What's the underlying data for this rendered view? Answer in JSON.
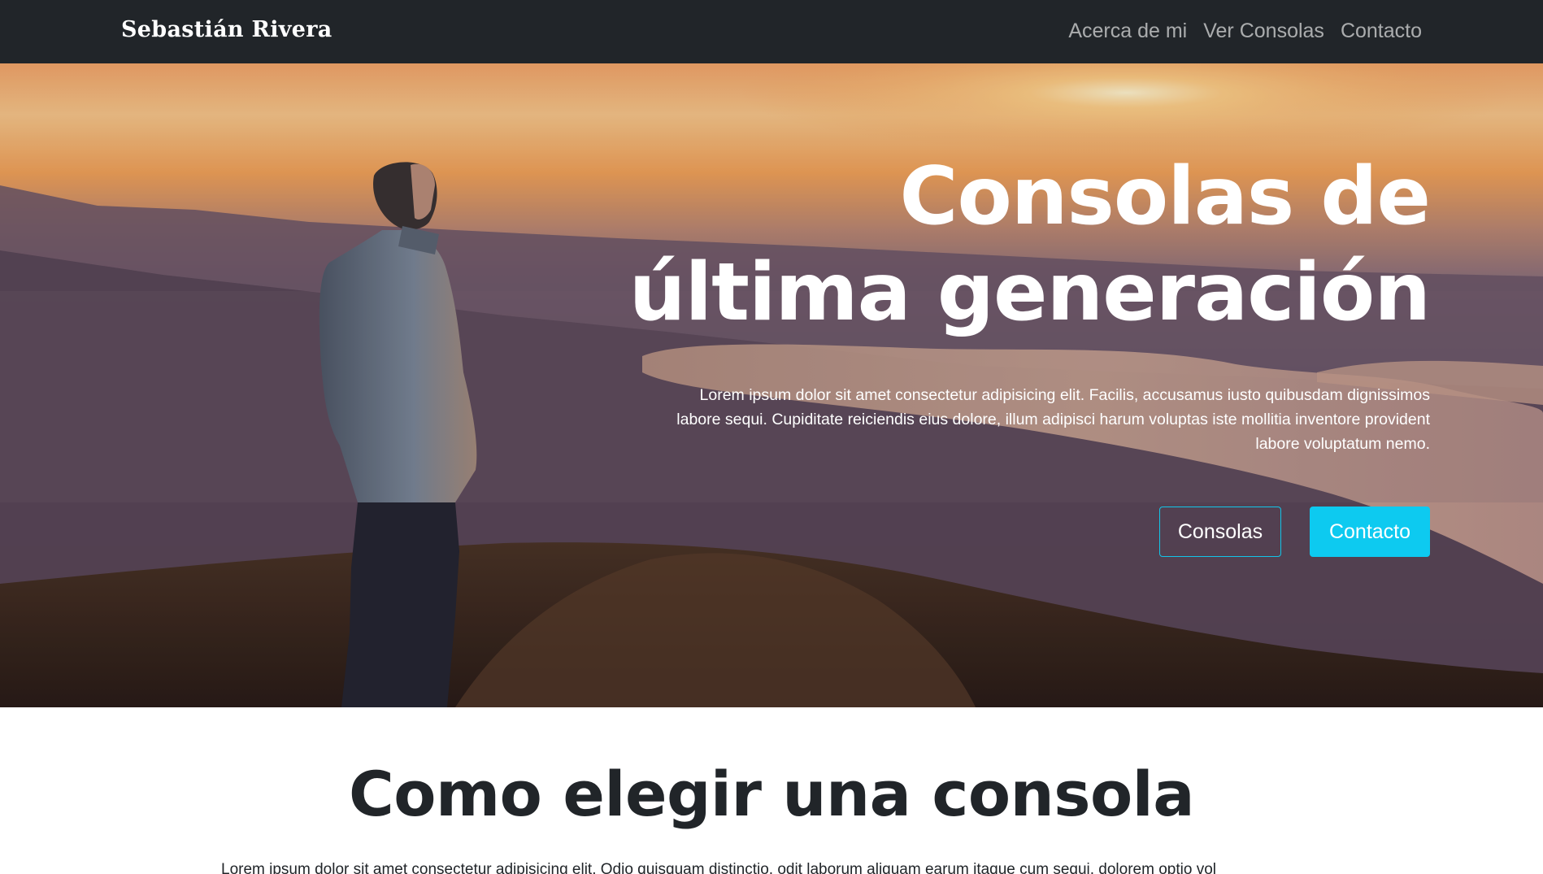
{
  "navbar": {
    "brand": "Sebastián Rivera",
    "links": [
      "Acerca de mi",
      "Ver Consolas",
      "Contacto"
    ]
  },
  "hero": {
    "title_line1": "Consolas de",
    "title_line2": "última generación",
    "text": "Lorem ipsum dolor sit amet consectetur adipisicing elit. Facilis, accusamus iusto quibusdam dignissimos labore sequi. Cupiditate reiciendis eius dolore, illum adipisci harum voluptas iste mollitia inventore provident labore voluptatum nemo.",
    "buttons": {
      "consolas": "Consolas",
      "contacto": "Contacto"
    }
  },
  "section": {
    "title": "Como elegir una consola",
    "text": "Lorem ipsum dolor sit amet consectetur adipisicing elit. Odio quisquam distinctio, odit laborum aliquam earum itaque cum sequi, dolorem optio vol"
  },
  "colors": {
    "navbar_bg": "#212529",
    "accent": "#0dcaf0",
    "text_dark": "#212529"
  }
}
